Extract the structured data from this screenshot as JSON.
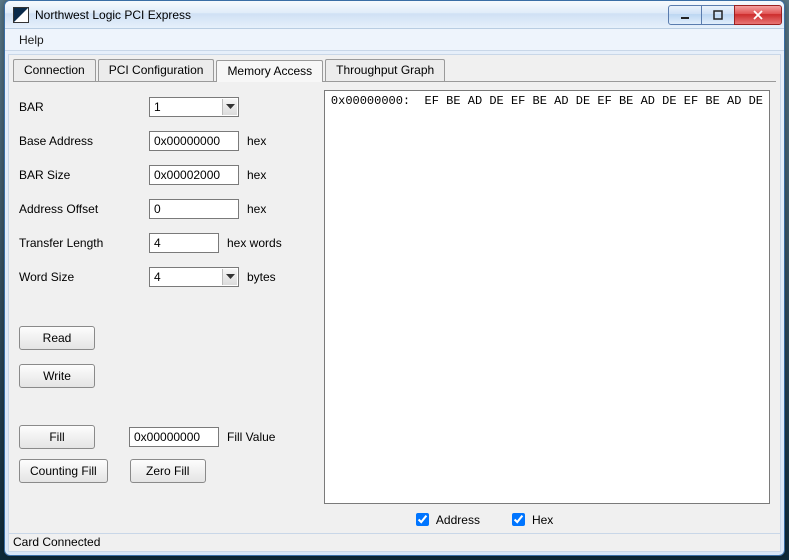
{
  "window": {
    "title": "Northwest Logic PCI Express"
  },
  "menu": {
    "help": "Help"
  },
  "tabs": {
    "connection": "Connection",
    "pci_config": "PCI Configuration",
    "memory_access": "Memory Access",
    "throughput_graph": "Throughput Graph"
  },
  "form": {
    "bar_label": "BAR",
    "bar_value": "1",
    "base_addr_label": "Base Address",
    "base_addr_value": "0x00000000",
    "bar_size_label": "BAR Size",
    "bar_size_value": "0x00002000",
    "addr_off_label": "Address Offset",
    "addr_off_value": "0",
    "xfer_len_label": "Transfer Length",
    "xfer_len_value": "4",
    "word_size_label": "Word Size",
    "word_size_value": "4",
    "unit_hex": "hex",
    "unit_hexwords": "hex words",
    "unit_bytes": "bytes"
  },
  "buttons": {
    "read": "Read",
    "write": "Write",
    "fill": "Fill",
    "counting_fill": "Counting Fill",
    "zero_fill": "Zero Fill"
  },
  "fill": {
    "value": "0x00000000",
    "label": "Fill Value"
  },
  "hex_output": "0x00000000:  EF BE AD DE EF BE AD DE EF BE AD DE EF BE AD DE",
  "checks": {
    "address": "Address",
    "hex": "Hex"
  },
  "status": "Card Connected"
}
